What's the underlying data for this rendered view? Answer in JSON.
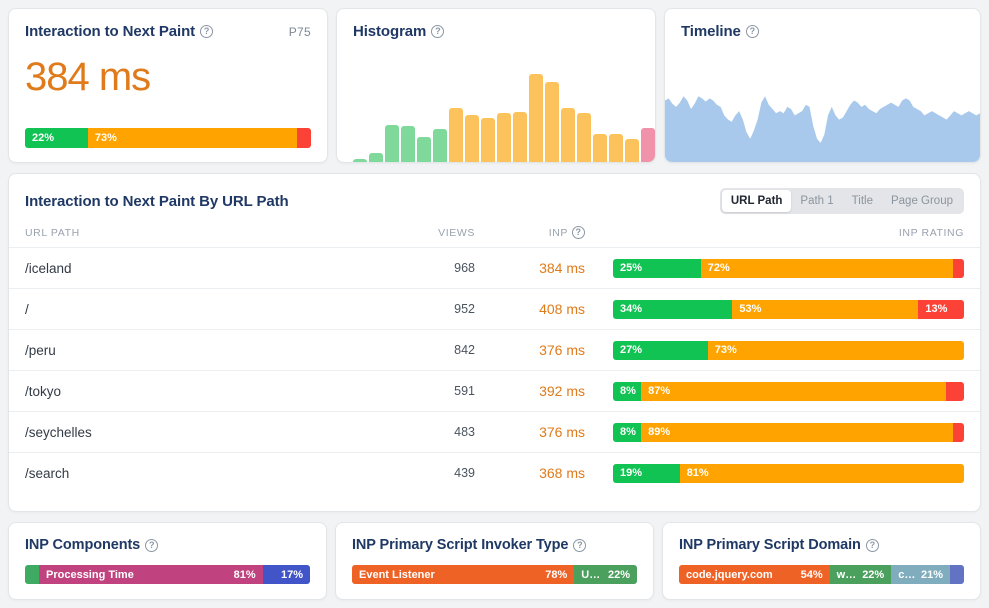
{
  "cards": {
    "inp": {
      "title": "Interaction to Next Paint",
      "percentile_label": "P75",
      "value": "384 ms",
      "help_glyph": "?",
      "rating_bar": [
        {
          "label": "22%",
          "pct": 22,
          "color": "#10c352"
        },
        {
          "label": "73%",
          "pct": 73,
          "color": "#ffa301"
        },
        {
          "label": "",
          "pct": 5,
          "color": "#fc4236"
        }
      ]
    },
    "histogram": {
      "title": "Histogram",
      "help_glyph": "?",
      "bars": [
        {
          "value": 3,
          "color": "#7fd99a"
        },
        {
          "value": 8,
          "color": "#7fd99a"
        },
        {
          "value": 34,
          "color": "#7fd99a"
        },
        {
          "value": 33,
          "color": "#7fd99a"
        },
        {
          "value": 23,
          "color": "#7fd99a"
        },
        {
          "value": 30,
          "color": "#7fd99a"
        },
        {
          "value": 49,
          "color": "#fcc35c"
        },
        {
          "value": 43,
          "color": "#fcc35c"
        },
        {
          "value": 40,
          "color": "#fcc35c"
        },
        {
          "value": 45,
          "color": "#fcc35c"
        },
        {
          "value": 46,
          "color": "#fcc35c"
        },
        {
          "value": 80,
          "color": "#fcc35c"
        },
        {
          "value": 73,
          "color": "#fcc35c"
        },
        {
          "value": 49,
          "color": "#fcc35c"
        },
        {
          "value": 45,
          "color": "#fcc35c"
        },
        {
          "value": 26,
          "color": "#fcc35c"
        },
        {
          "value": 26,
          "color": "#fcc35c"
        },
        {
          "value": 21,
          "color": "#fcc35c"
        },
        {
          "value": 31,
          "color": "#f092aa"
        }
      ],
      "max": 84
    },
    "timeline": {
      "title": "Timeline",
      "help_glyph": "?",
      "fill_color": "#a8c9ec",
      "points": [
        58,
        60,
        55,
        52,
        56,
        62,
        58,
        50,
        55,
        62,
        60,
        57,
        60,
        58,
        54,
        52,
        44,
        40,
        38,
        44,
        48,
        40,
        28,
        22,
        30,
        40,
        56,
        62,
        54,
        50,
        46,
        48,
        46,
        52,
        50,
        44,
        46,
        48,
        54,
        52,
        34,
        22,
        18,
        26,
        44,
        52,
        44,
        40,
        42,
        48,
        54,
        58,
        56,
        52,
        54,
        50,
        48,
        46,
        50,
        52,
        54,
        56,
        54,
        52,
        58,
        60,
        58,
        52,
        50,
        48,
        44,
        46,
        48,
        46,
        44,
        42,
        40,
        44,
        48,
        46,
        44,
        46,
        48,
        46,
        44,
        46
      ]
    }
  },
  "table": {
    "title": "Interaction to Next Paint By URL Path",
    "toggle": {
      "options": [
        "URL Path",
        "Path 1",
        "Title",
        "Page Group"
      ],
      "selected": "URL Path"
    },
    "columns": {
      "path": "URL PATH",
      "views": "VIEWS",
      "inp": "INP",
      "rating": "INP RATING",
      "inp_help_glyph": "?"
    },
    "rows": [
      {
        "path": "/iceland",
        "views": "968",
        "inp": "384 ms",
        "rating": [
          {
            "label": "25%",
            "pct": 25,
            "color": "#10c352"
          },
          {
            "label": "72%",
            "pct": 72,
            "color": "#ffa301"
          },
          {
            "label": "",
            "pct": 3,
            "color": "#fc4236"
          }
        ]
      },
      {
        "path": "/",
        "views": "952",
        "inp": "408 ms",
        "rating": [
          {
            "label": "34%",
            "pct": 34,
            "color": "#10c352"
          },
          {
            "label": "53%",
            "pct": 53,
            "color": "#ffa301"
          },
          {
            "label": "13%",
            "pct": 13,
            "color": "#fc4236"
          }
        ]
      },
      {
        "path": "/peru",
        "views": "842",
        "inp": "376 ms",
        "rating": [
          {
            "label": "27%",
            "pct": 27,
            "color": "#10c352"
          },
          {
            "label": "73%",
            "pct": 73,
            "color": "#ffa301"
          },
          {
            "label": "",
            "pct": 0,
            "color": "#fc4236"
          }
        ]
      },
      {
        "path": "/tokyo",
        "views": "591",
        "inp": "392 ms",
        "rating": [
          {
            "label": "8%",
            "pct": 8,
            "color": "#10c352"
          },
          {
            "label": "87%",
            "pct": 87,
            "color": "#ffa301"
          },
          {
            "label": "",
            "pct": 5,
            "color": "#fc4236"
          }
        ]
      },
      {
        "path": "/seychelles",
        "views": "483",
        "inp": "376 ms",
        "rating": [
          {
            "label": "8%",
            "pct": 8,
            "color": "#10c352"
          },
          {
            "label": "89%",
            "pct": 89,
            "color": "#ffa301"
          },
          {
            "label": "",
            "pct": 3,
            "color": "#fc4236"
          }
        ]
      },
      {
        "path": "/search",
        "views": "439",
        "inp": "368 ms",
        "rating": [
          {
            "label": "19%",
            "pct": 19,
            "color": "#10c352"
          },
          {
            "label": "81%",
            "pct": 81,
            "color": "#ffa301"
          },
          {
            "label": "",
            "pct": 0,
            "color": "#fc4236"
          }
        ]
      }
    ]
  },
  "bottom": [
    {
      "title": "INP Components",
      "help_glyph": "?",
      "segments": [
        {
          "name": "",
          "label": "",
          "pct": 2,
          "color": "#3faa62"
        },
        {
          "name": "Processing Time",
          "label": "81%",
          "pct": 81,
          "color": "#c0437f"
        },
        {
          "name": "",
          "label": "17%",
          "pct": 17,
          "color": "#4155c8"
        }
      ]
    },
    {
      "title": "INP Primary Script Invoker Type",
      "help_glyph": "?",
      "segments": [
        {
          "name": "Event Listener",
          "label": "78%",
          "pct": 78,
          "color": "#ef6226"
        },
        {
          "name": "U…",
          "label": "22%",
          "pct": 22,
          "color": "#4ba05e"
        }
      ]
    },
    {
      "title": "INP Primary Script Domain",
      "help_glyph": "?",
      "segments": [
        {
          "name": "code.jquery.com",
          "label": "54%",
          "pct": 54,
          "color": "#ef6226"
        },
        {
          "name": "w…",
          "label": "22%",
          "pct": 22,
          "color": "#4ba05e"
        },
        {
          "name": "c…",
          "label": "21%",
          "pct": 21,
          "color": "#7fadbd"
        },
        {
          "name": "",
          "label": "",
          "pct": 3,
          "color": "#6273c4"
        }
      ]
    }
  ]
}
